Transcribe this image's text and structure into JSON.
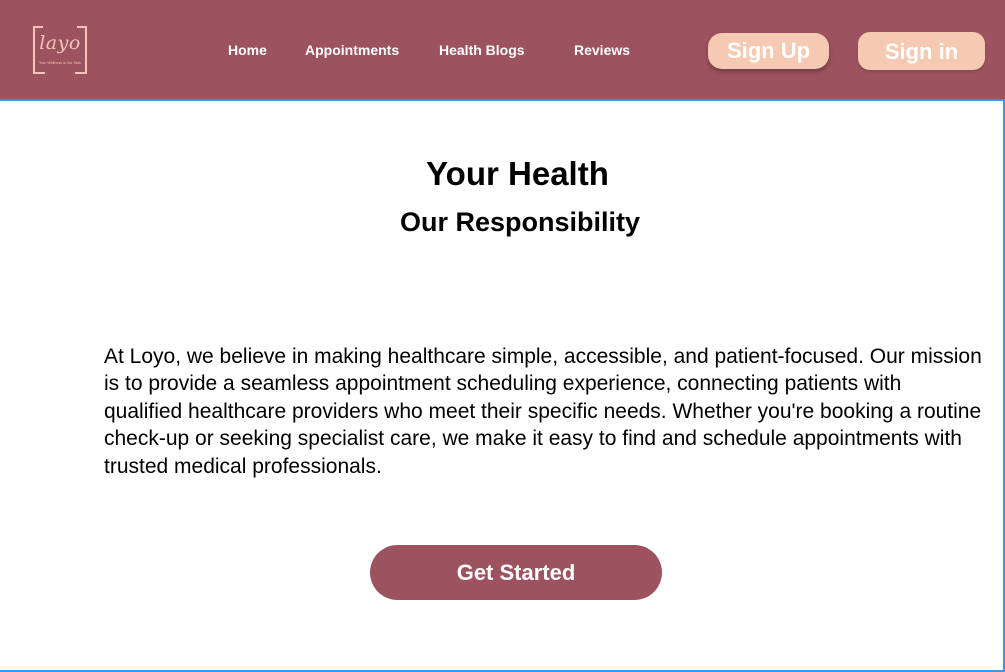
{
  "brand": {
    "logo_text": "layo",
    "tagline": "Your Wellness is Our Task"
  },
  "nav": {
    "items": [
      {
        "label": "Home"
      },
      {
        "label": "Appointments"
      },
      {
        "label": "Health Blogs"
      },
      {
        "label": "Reviews"
      }
    ]
  },
  "auth": {
    "signup_label": "Sign Up",
    "signin_label": "Sign in"
  },
  "hero": {
    "title": "Your Health",
    "subtitle": "Our Responsibility",
    "description": "At Loyo, we believe in making healthcare simple, accessible, and patient-focused. Our mission is to provide a seamless appointment scheduling experience, connecting patients with qualified healthcare providers who meet their specific needs. Whether you're booking a routine check-up or seeking specialist care, we make it easy to find and schedule appointments with trusted medical professionals.",
    "cta_label": "Get Started"
  },
  "colors": {
    "header_bg": "#9c525f",
    "auth_button_bg": "#f6c9b3",
    "cta_bg": "#9c525f",
    "frame_border": "#3b97e3"
  }
}
